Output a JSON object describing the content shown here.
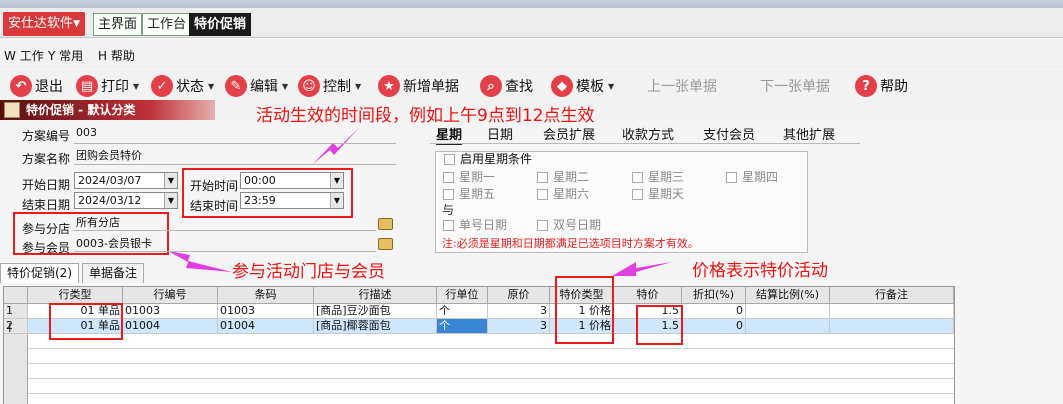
{
  "app": {
    "menu_label": "安仕达软件"
  },
  "tabs": {
    "home": "主界面",
    "workbench": "工作台",
    "promo": "特价促销"
  },
  "menubar": [
    {
      "key": "W",
      "label": "工作"
    },
    {
      "key": "Y",
      "label": "常用"
    },
    {
      "key": "H",
      "label": "帮助"
    }
  ],
  "toolbar": {
    "exit": "退出",
    "print": "打印",
    "status": "状态",
    "edit": "编辑",
    "control": "控制",
    "new_doc": "新增单据",
    "find": "查找",
    "template": "模板",
    "prev_doc": "上一张单据",
    "next_doc": "下一张单据",
    "help": "帮助"
  },
  "section": {
    "title": "特价促销 - 默认分类"
  },
  "annotations": {
    "time": "活动生效的时间段，例如上午9点到12点生效",
    "store_member": "参与活动门店与会员",
    "price": "价格表示特价活动"
  },
  "form": {
    "plan_no_label": "方案编号",
    "plan_no": "003",
    "plan_name_label": "方案名称",
    "plan_name": "团购会员特价",
    "start_date_label": "开始日期",
    "start_date": "2024/03/07",
    "end_date_label": "结束日期",
    "end_date": "2024/03/12",
    "start_time_label": "开始时间",
    "start_time": "00:00",
    "end_time_label": "结束时间",
    "end_time": "23:59",
    "store_label": "参与分店",
    "store": "所有分店",
    "member_label": "参与会员",
    "member": "0003-会员银卡"
  },
  "right_tabs": [
    "星期",
    "日期",
    "会员扩展",
    "收款方式",
    "支付会员",
    "其他扩展"
  ],
  "week": {
    "enable_label": "启用星期条件",
    "days": [
      "星期一",
      "星期二",
      "星期三",
      "星期四",
      "星期五",
      "星期六",
      "星期天"
    ],
    "and_label": "与",
    "odd": "单号日期",
    "even": "双号日期",
    "note": "注:必须是星期和日期都满足已选项目时方案才有效。"
  },
  "grid_tabs": {
    "detail": "特价促销(2)",
    "remark": "单据备注"
  },
  "grid": {
    "headers": [
      "行类型",
      "行编号",
      "条码",
      "行描述",
      "行单位",
      "原价",
      "特价类型",
      "特价",
      "折扣(%)",
      "结算比例(%)",
      "行备注"
    ],
    "rows": [
      {
        "no": "1",
        "type": "01 单品",
        "code": "01003",
        "barcode": "01003",
        "desc": "[商品]豆沙面包",
        "unit": "个",
        "orig": "3",
        "ptype": "1 价格",
        "price": "1.5",
        "discount": "0",
        "settle": "",
        "remark": ""
      },
      {
        "no": "2",
        "type": "01 单品",
        "code": "01004",
        "barcode": "01004",
        "desc": "[商品]椰蓉面包",
        "unit": "个",
        "orig": "3",
        "ptype": "1 价格",
        "price": "1.5",
        "discount": "0",
        "settle": "",
        "remark": ""
      }
    ]
  }
}
